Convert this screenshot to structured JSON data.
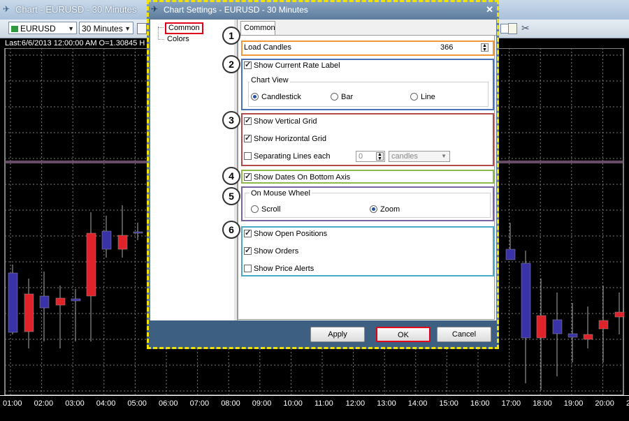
{
  "window": {
    "title": "Chart - EURUSD - 30 Minutes",
    "symbol": "EURUSD",
    "timeframe": "30 Minutes",
    "info_line": "Last:6/6/2013 12:00:00 AM O=1.30845 H"
  },
  "x_axis_labels": [
    "01:00",
    "02:00",
    "03:00",
    "04:00",
    "05:00",
    "06:00",
    "07:00",
    "08:00",
    "09:00",
    "10:00",
    "11:00",
    "12:00",
    "13:00",
    "14:00",
    "15:00",
    "16:00",
    "17:00",
    "18:00",
    "19:00",
    "20:00",
    "2"
  ],
  "colors": {
    "bull": "#e0222a",
    "bear": "#3a33a8",
    "grid": "#7d7d7d",
    "rate_line": "#7a5a7a",
    "highlight_yellow": "#f2e200"
  },
  "dialog": {
    "title": "Chart Settings - EURUSD - 30 Minutes",
    "tree": [
      "Common",
      "Colors"
    ],
    "tab": "Common",
    "load_candles": {
      "label": "Load Candles",
      "value": "366"
    },
    "show_current_rate_label": {
      "label": "Show Current Rate Label",
      "checked": true
    },
    "chart_view": {
      "label": "Chart View",
      "options": [
        "Candlestick",
        "Bar",
        "Line"
      ],
      "selected": "Candlestick"
    },
    "show_vertical_grid": {
      "label": "Show Vertical Grid",
      "checked": true
    },
    "show_horizontal_grid": {
      "label": "Show Horizontal Grid",
      "checked": true
    },
    "separating_lines": {
      "label": "Separating Lines each",
      "checked": false,
      "value": "0",
      "unit": "candles"
    },
    "show_dates_bottom": {
      "label": "Show Dates On Bottom Axis",
      "checked": true
    },
    "mouse_wheel": {
      "label": "On Mouse Wheel",
      "options": [
        "Scroll",
        "Zoom"
      ],
      "selected": "Zoom"
    },
    "show_open_positions": {
      "label": "Show Open Positions",
      "checked": true
    },
    "show_orders": {
      "label": "Show Orders",
      "checked": true
    },
    "show_price_alerts": {
      "label": "Show Price Alerts",
      "checked": false
    },
    "badges": [
      "1",
      "2",
      "3",
      "4",
      "5",
      "6"
    ],
    "buttons": {
      "apply": "Apply",
      "ok": "OK",
      "cancel": "Cancel"
    }
  }
}
